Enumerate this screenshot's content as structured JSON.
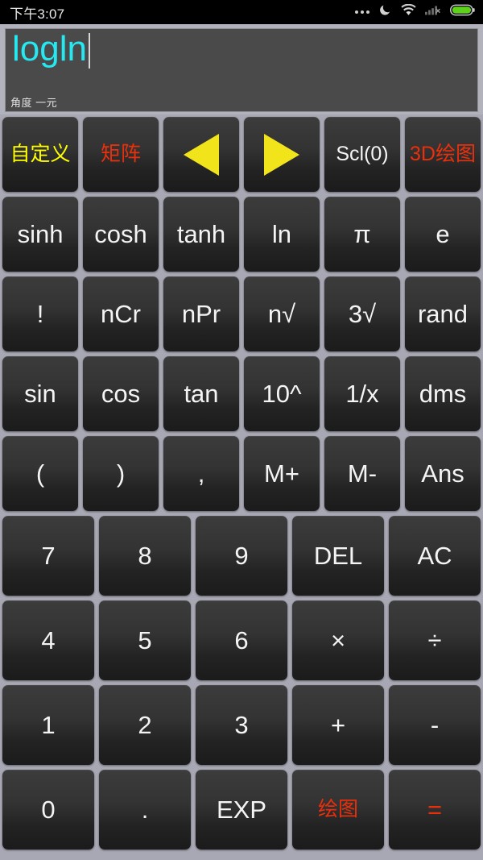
{
  "statusbar": {
    "time": "下午3:07",
    "icons": [
      "more-dots-icon",
      "do-not-disturb-moon-icon",
      "wifi-icon",
      "signal-no-service-icon",
      "battery-full-icon"
    ],
    "battery_color": "#5ed11b"
  },
  "display": {
    "expression": "logln",
    "caret_visible": true,
    "mode_line": "角度 一元",
    "text_color": "#25e8f0",
    "background": "#4a4a4a"
  },
  "colors": {
    "page_background": "#a8a8b4",
    "key_face_top": "#3c3c3c",
    "key_face_bottom": "#1b1b1b",
    "yellow": "#ffff00",
    "red": "#ea2f0b",
    "white": "#f2f2f2",
    "arrow_yellow": "#f2e41a"
  },
  "keypad": {
    "rows": [
      {
        "columns": 6,
        "keys": [
          {
            "label": "自定义",
            "name": "key-custom",
            "style": "cjk yellow",
            "kind": "text"
          },
          {
            "label": "矩阵",
            "name": "key-matrix",
            "style": "cjk red",
            "kind": "text"
          },
          {
            "label": "◀",
            "name": "key-cursor-left",
            "style": "white",
            "kind": "triangle-left"
          },
          {
            "label": "▶",
            "name": "key-cursor-right",
            "style": "white",
            "kind": "triangle-right"
          },
          {
            "label": "Scl(0)",
            "name": "key-scl",
            "style": "small white",
            "kind": "text"
          },
          {
            "label": "3D绘图",
            "name": "key-3d-plot",
            "style": "cjk red",
            "kind": "text"
          }
        ]
      },
      {
        "columns": 6,
        "keys": [
          {
            "label": "sinh",
            "name": "key-sinh",
            "style": "white",
            "kind": "text"
          },
          {
            "label": "cosh",
            "name": "key-cosh",
            "style": "white",
            "kind": "text"
          },
          {
            "label": "tanh",
            "name": "key-tanh",
            "style": "white",
            "kind": "text"
          },
          {
            "label": "ln",
            "name": "key-ln",
            "style": "white",
            "kind": "text"
          },
          {
            "label": "π",
            "name": "key-pi",
            "style": "white",
            "kind": "text"
          },
          {
            "label": "e",
            "name": "key-e",
            "style": "white",
            "kind": "text"
          }
        ]
      },
      {
        "columns": 6,
        "keys": [
          {
            "label": "!",
            "name": "key-factorial",
            "style": "white",
            "kind": "text"
          },
          {
            "label": "nCr",
            "name": "key-ncr",
            "style": "white",
            "kind": "text"
          },
          {
            "label": "nPr",
            "name": "key-npr",
            "style": "white",
            "kind": "text"
          },
          {
            "label": "n√",
            "name": "key-nth-root",
            "style": "white",
            "kind": "text"
          },
          {
            "label": "3√",
            "name": "key-cube-root",
            "style": "white",
            "kind": "text"
          },
          {
            "label": "rand",
            "name": "key-rand",
            "style": "white",
            "kind": "text"
          }
        ]
      },
      {
        "columns": 6,
        "keys": [
          {
            "label": "sin",
            "name": "key-sin",
            "style": "white",
            "kind": "text"
          },
          {
            "label": "cos",
            "name": "key-cos",
            "style": "white",
            "kind": "text"
          },
          {
            "label": "tan",
            "name": "key-tan",
            "style": "white",
            "kind": "text"
          },
          {
            "label": "10^",
            "name": "key-ten-power",
            "style": "white",
            "kind": "text"
          },
          {
            "label": "1/x",
            "name": "key-reciprocal",
            "style": "white",
            "kind": "text"
          },
          {
            "label": "dms",
            "name": "key-dms",
            "style": "white",
            "kind": "text"
          }
        ]
      },
      {
        "columns": 6,
        "keys": [
          {
            "label": "(",
            "name": "key-paren-open",
            "style": "white",
            "kind": "text"
          },
          {
            "label": ")",
            "name": "key-paren-close",
            "style": "white",
            "kind": "text"
          },
          {
            "label": ",",
            "name": "key-comma",
            "style": "white",
            "kind": "text"
          },
          {
            "label": "M+",
            "name": "key-memory-plus",
            "style": "white",
            "kind": "text"
          },
          {
            "label": "M-",
            "name": "key-memory-minus",
            "style": "white",
            "kind": "text"
          },
          {
            "label": "Ans",
            "name": "key-answer",
            "style": "white",
            "kind": "text"
          }
        ]
      },
      {
        "columns": 5,
        "keys": [
          {
            "label": "7",
            "name": "key-7",
            "style": "white",
            "kind": "text"
          },
          {
            "label": "8",
            "name": "key-8",
            "style": "white",
            "kind": "text"
          },
          {
            "label": "9",
            "name": "key-9",
            "style": "white",
            "kind": "text"
          },
          {
            "label": "DEL",
            "name": "key-delete",
            "style": "white",
            "kind": "text"
          },
          {
            "label": "AC",
            "name": "key-all-clear",
            "style": "white",
            "kind": "text"
          }
        ]
      },
      {
        "columns": 5,
        "keys": [
          {
            "label": "4",
            "name": "key-4",
            "style": "white",
            "kind": "text"
          },
          {
            "label": "5",
            "name": "key-5",
            "style": "white",
            "kind": "text"
          },
          {
            "label": "6",
            "name": "key-6",
            "style": "white",
            "kind": "text"
          },
          {
            "label": "×",
            "name": "key-multiply",
            "style": "white",
            "kind": "text"
          },
          {
            "label": "÷",
            "name": "key-divide",
            "style": "white",
            "kind": "text"
          }
        ]
      },
      {
        "columns": 5,
        "keys": [
          {
            "label": "1",
            "name": "key-1",
            "style": "white",
            "kind": "text"
          },
          {
            "label": "2",
            "name": "key-2",
            "style": "white",
            "kind": "text"
          },
          {
            "label": "3",
            "name": "key-3",
            "style": "white",
            "kind": "text"
          },
          {
            "label": "+",
            "name": "key-plus",
            "style": "white",
            "kind": "text"
          },
          {
            "label": "-",
            "name": "key-minus",
            "style": "white",
            "kind": "text"
          }
        ]
      },
      {
        "columns": 5,
        "keys": [
          {
            "label": "0",
            "name": "key-0",
            "style": "white",
            "kind": "text"
          },
          {
            "label": ".",
            "name": "key-decimal",
            "style": "white",
            "kind": "text"
          },
          {
            "label": "EXP",
            "name": "key-exponent",
            "style": "white",
            "kind": "text"
          },
          {
            "label": "绘图",
            "name": "key-plot",
            "style": "cjk red",
            "kind": "text"
          },
          {
            "label": "=",
            "name": "key-equals",
            "style": "red",
            "kind": "text"
          }
        ]
      }
    ]
  }
}
